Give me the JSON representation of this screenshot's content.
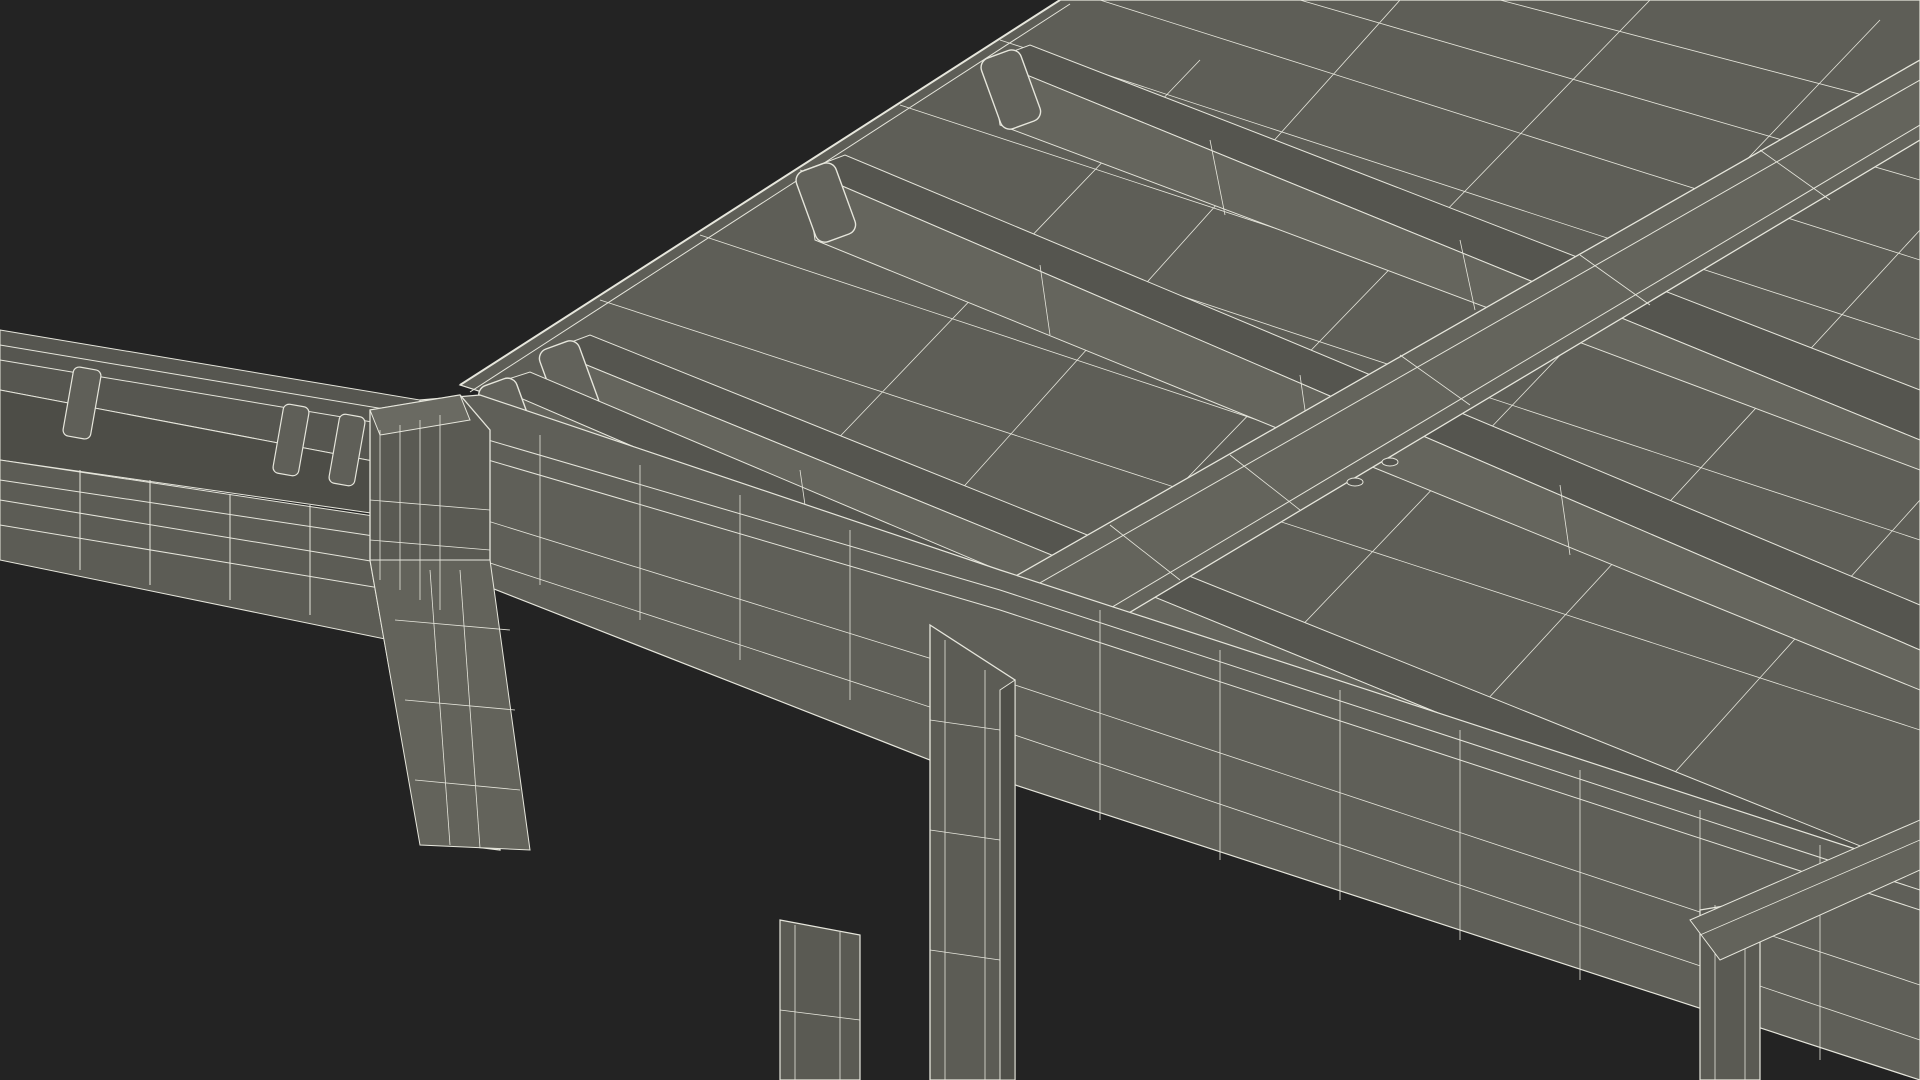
{
  "scene": {
    "subject": "wireframe-roof-canopy-structure",
    "render_style": "wireframe-over-shaded",
    "colors": {
      "background": "#232323",
      "surface": "#5f5f58",
      "surface_dark": "#4e4e48",
      "surface_light": "#6a6a62",
      "wire": "#e6e6dc"
    }
  }
}
